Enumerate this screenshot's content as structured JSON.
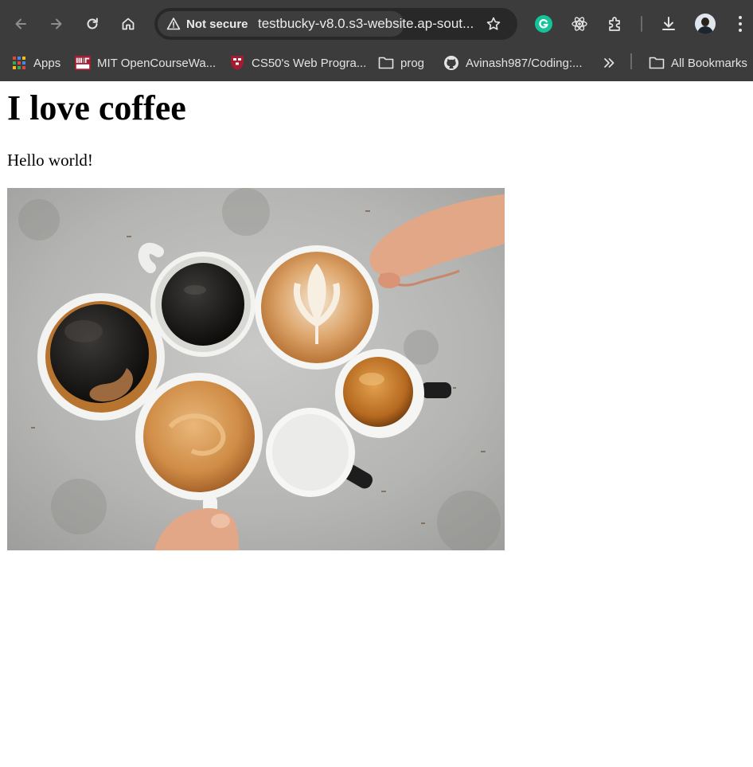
{
  "browser": {
    "security_chip": "Not secure",
    "url": "testbucky-v8.0.s3-website.ap-sout...",
    "bookmarks": [
      {
        "label": "Apps",
        "icon": "apps-grid-icon"
      },
      {
        "label": "MIT OpenCourseWa...",
        "icon": "mit-ocw-icon"
      },
      {
        "label": "CS50's Web Progra...",
        "icon": "harvard-shield-icon"
      },
      {
        "label": "prog",
        "icon": "folder-icon"
      },
      {
        "label": "Avinash987/Coding:...",
        "icon": "github-icon"
      },
      {
        "label": "All Bookmarks",
        "icon": "folder-icon"
      }
    ],
    "mit_logo_text": "MIT OCW"
  },
  "page": {
    "heading": "I love coffee",
    "paragraph": "Hello world!",
    "image_subject": "cups of coffee on a concrete table"
  },
  "colors": {
    "chrome_bg": "#3c3c3c",
    "omnibox_bg": "#282828",
    "chip_bg": "#3d3d3d",
    "grammarly_green": "#15c39a"
  }
}
